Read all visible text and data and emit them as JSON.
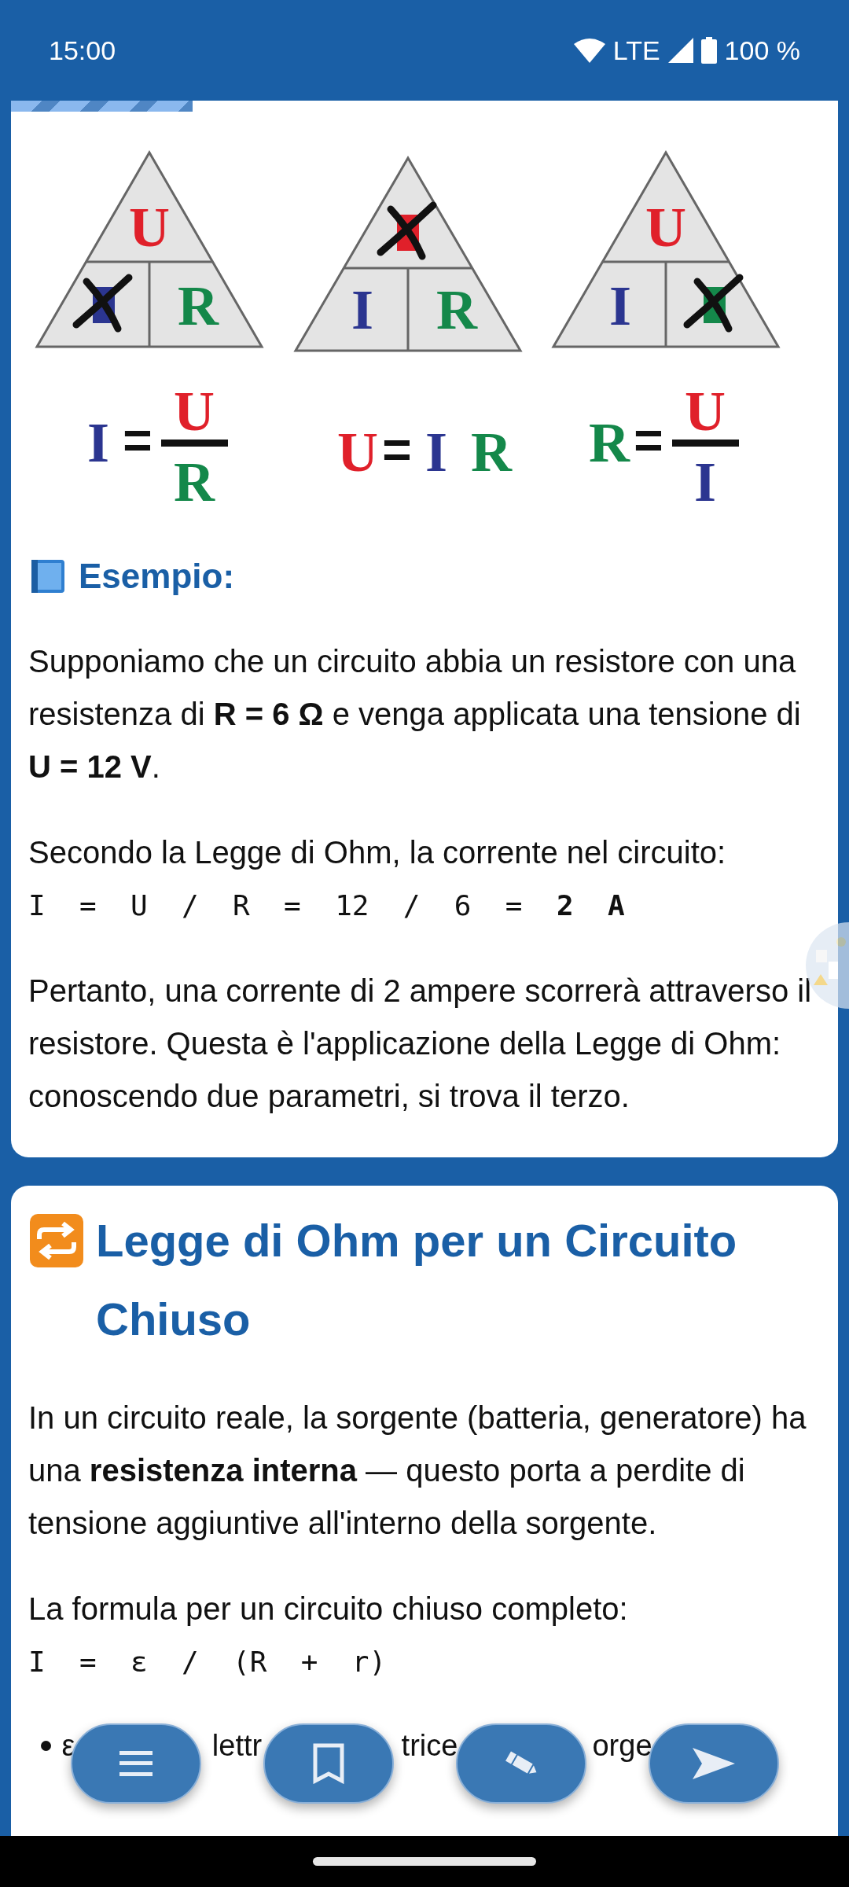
{
  "status_bar": {
    "time": "15:00",
    "network": "LTE",
    "battery": "100 %"
  },
  "card_1": {
    "diagram": {
      "triangles": [
        {
          "cells": [
            {
              "text": "U",
              "color": "#e0202a",
              "crossed": false
            },
            {
              "color": "#2b3590",
              "crossed": true
            },
            {
              "text": "R",
              "color": "#14884a",
              "crossed": false
            }
          ]
        },
        {
          "cells": [
            {
              "color": "#e0202a",
              "crossed": true
            },
            {
              "text": "I",
              "color": "#2b3590",
              "crossed": false
            },
            {
              "text": "R",
              "color": "#14884a",
              "crossed": false
            }
          ]
        },
        {
          "cells": [
            {
              "text": "U",
              "color": "#e0202a",
              "crossed": false
            },
            {
              "text": "I",
              "color": "#2b3590",
              "crossed": false
            },
            {
              "color": "#14884a",
              "crossed": true
            }
          ]
        }
      ],
      "formulas": [
        {
          "kind": "fraction",
          "lhs": {
            "text": "I",
            "color": "#2b3590"
          },
          "eq": "=",
          "num": {
            "text": "U",
            "color": "#e0202a"
          },
          "den": {
            "text": "R",
            "color": "#14884a"
          }
        },
        {
          "kind": "product",
          "lhs": {
            "text": "U",
            "color": "#e0202a"
          },
          "eq": "=",
          "terms": [
            {
              "text": "I",
              "color": "#2b3590"
            },
            {
              "text": "R",
              "color": "#14884a"
            }
          ]
        },
        {
          "kind": "fraction",
          "lhs": {
            "text": "R",
            "color": "#14884a"
          },
          "eq": "=",
          "num": {
            "text": "U",
            "color": "#e0202a"
          },
          "den": {
            "text": "I",
            "color": "#2b3590"
          }
        }
      ]
    },
    "heading": "Esempio:",
    "blocks": [
      {
        "kind": "paragraph",
        "text": "Supponiamo che un circuito abbia un resistore con una resistenza di **R = 6 Ω** e venga applicata una tensione di **U = 12 V**."
      },
      {
        "kind": "paragraph",
        "text": "Secondo la Legge di Ohm, la corrente nel circuito:"
      },
      {
        "kind": "code",
        "text": "I = U / R = 12 / 6 = **2 A**"
      },
      {
        "kind": "paragraph",
        "text": "Pertanto, una corrente di 2 ampere scorrerà attraverso il resistore. Questa è l'applicazione della Legge di Ohm: conoscendo due parametri, si trova il terzo."
      }
    ]
  },
  "card_2": {
    "heading": "Legge di Ohm per un Circuito Chiuso",
    "blocks": [
      {
        "kind": "paragraph",
        "text": "In un circuito reale, la sorgente (batteria, generatore) ha una **resistenza interna** — questo porta a perdite di tensione aggiuntive all'interno della sorgente."
      },
      {
        "kind": "paragraph",
        "text": "La formula per un circuito chiuso completo:"
      },
      {
        "kind": "code",
        "text": "I = ε / (R + r)"
      },
      {
        "kind": "bullet",
        "fragments": [
          "ε",
          "lettr",
          "trice",
          "orge"
        ]
      }
    ]
  },
  "action_buttons": [
    {
      "kind": "menu"
    },
    {
      "kind": "bookmark"
    },
    {
      "kind": "edit"
    },
    {
      "kind": "send"
    }
  ]
}
